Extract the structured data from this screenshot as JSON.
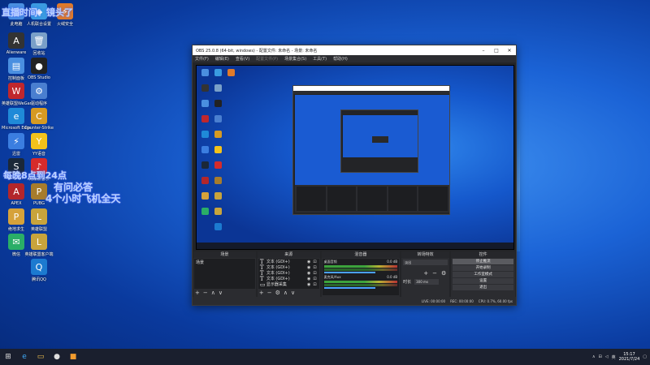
{
  "desktop": {
    "icons": [
      {
        "label": "此电脑",
        "glyph": "■",
        "color": "#4a8fe0"
      },
      {
        "label": "人机联合设置",
        "glyph": "◆",
        "color": "#3a9be0"
      },
      {
        "label": "火绒安全",
        "glyph": "⚡",
        "color": "#e07a2a"
      },
      {
        "label": "回收站",
        "glyph": "🗑",
        "color": "#7aa0c8"
      },
      {
        "label": "Alienware",
        "glyph": "A",
        "color": "#333"
      },
      {
        "label": "OBS Studio",
        "glyph": "●",
        "color": "#222"
      },
      {
        "label": "控制面板",
        "glyph": "▤",
        "color": "#4a8fe0"
      },
      {
        "label": "驱动程序",
        "glyph": "⚙",
        "color": "#4a7fd0"
      },
      {
        "label": "英雄联盟WeGame",
        "glyph": "W",
        "color": "#c0272d"
      },
      {
        "label": "Counter-Strike",
        "glyph": "C",
        "color": "#d69a22"
      },
      {
        "label": "Microsoft Edge",
        "glyph": "e",
        "color": "#1f8ad8"
      },
      {
        "label": "YY语音",
        "glyph": "Y",
        "color": "#f3c21b"
      },
      {
        "label": "迅雷",
        "glyph": "⚡",
        "color": "#3b7ee0"
      },
      {
        "label": "网易云音乐",
        "glyph": "♪",
        "color": "#d62b2b"
      },
      {
        "label": "Steam",
        "glyph": "S",
        "color": "#1b2838"
      },
      {
        "label": "PUBG",
        "glyph": "P",
        "color": "#a77c2c"
      },
      {
        "label": "APEX",
        "glyph": "A",
        "color": "#b3262b"
      },
      {
        "label": "英雄联盟",
        "glyph": "L",
        "color": "#c8a43c"
      },
      {
        "label": "绝地求生",
        "glyph": "P",
        "color": "#d6a23a"
      },
      {
        "label": "英雄联盟客户端",
        "glyph": "L",
        "color": "#c8a43c"
      },
      {
        "label": "微信",
        "glyph": "✉",
        "color": "#2aae67"
      },
      {
        "label": "腾讯QQ",
        "glyph": "Q",
        "color": "#1c7ad0"
      }
    ],
    "overlay": {
      "line1": "直播时间：镜头了",
      "line2": "每晚8点到24点",
      "line3": "有问必答",
      "line4": "4个小时飞机全天"
    }
  },
  "obs": {
    "title": "OBS 25.0.8 (64-bit, windows) - 配置文件: 未命名 - 场景: 未命名",
    "menu": [
      "文件(F)",
      "编辑(E)",
      "查看(V)",
      "配置文件(P)",
      "场景集合(S)",
      "工具(T)",
      "帮助(H)"
    ],
    "docks": {
      "scenes": {
        "title": "场景",
        "items": [
          "场景"
        ]
      },
      "sources": {
        "title": "来源",
        "items": [
          {
            "name": "文本 (GDI+)"
          },
          {
            "name": "文本 (GDI+)"
          },
          {
            "name": "文本 (GDI+)"
          },
          {
            "name": "文本 (GDI+)"
          },
          {
            "name": "显示器采集"
          }
        ]
      },
      "mixer": {
        "title": "混音器",
        "channels": [
          {
            "name": "桌面音频",
            "db": "0.0 dB"
          },
          {
            "name": "麦克风/Aux",
            "db": "0.0 dB"
          }
        ]
      },
      "transitions": {
        "title": "转场特效",
        "selected": "淡出",
        "duration_label": "时长",
        "duration_value": "300 ms"
      },
      "controls": {
        "title": "控件",
        "buttons": [
          "停止推流",
          "开始录制",
          "工作室模式",
          "设置",
          "退出"
        ]
      }
    },
    "status": {
      "live": "LIVE: 00:00:00",
      "rec": "REC: 00:00:00",
      "cpu": "CPU: 0.7%, 60.00 fps"
    }
  },
  "taskbar": {
    "time": "15:17",
    "date": "2021/7/24"
  }
}
